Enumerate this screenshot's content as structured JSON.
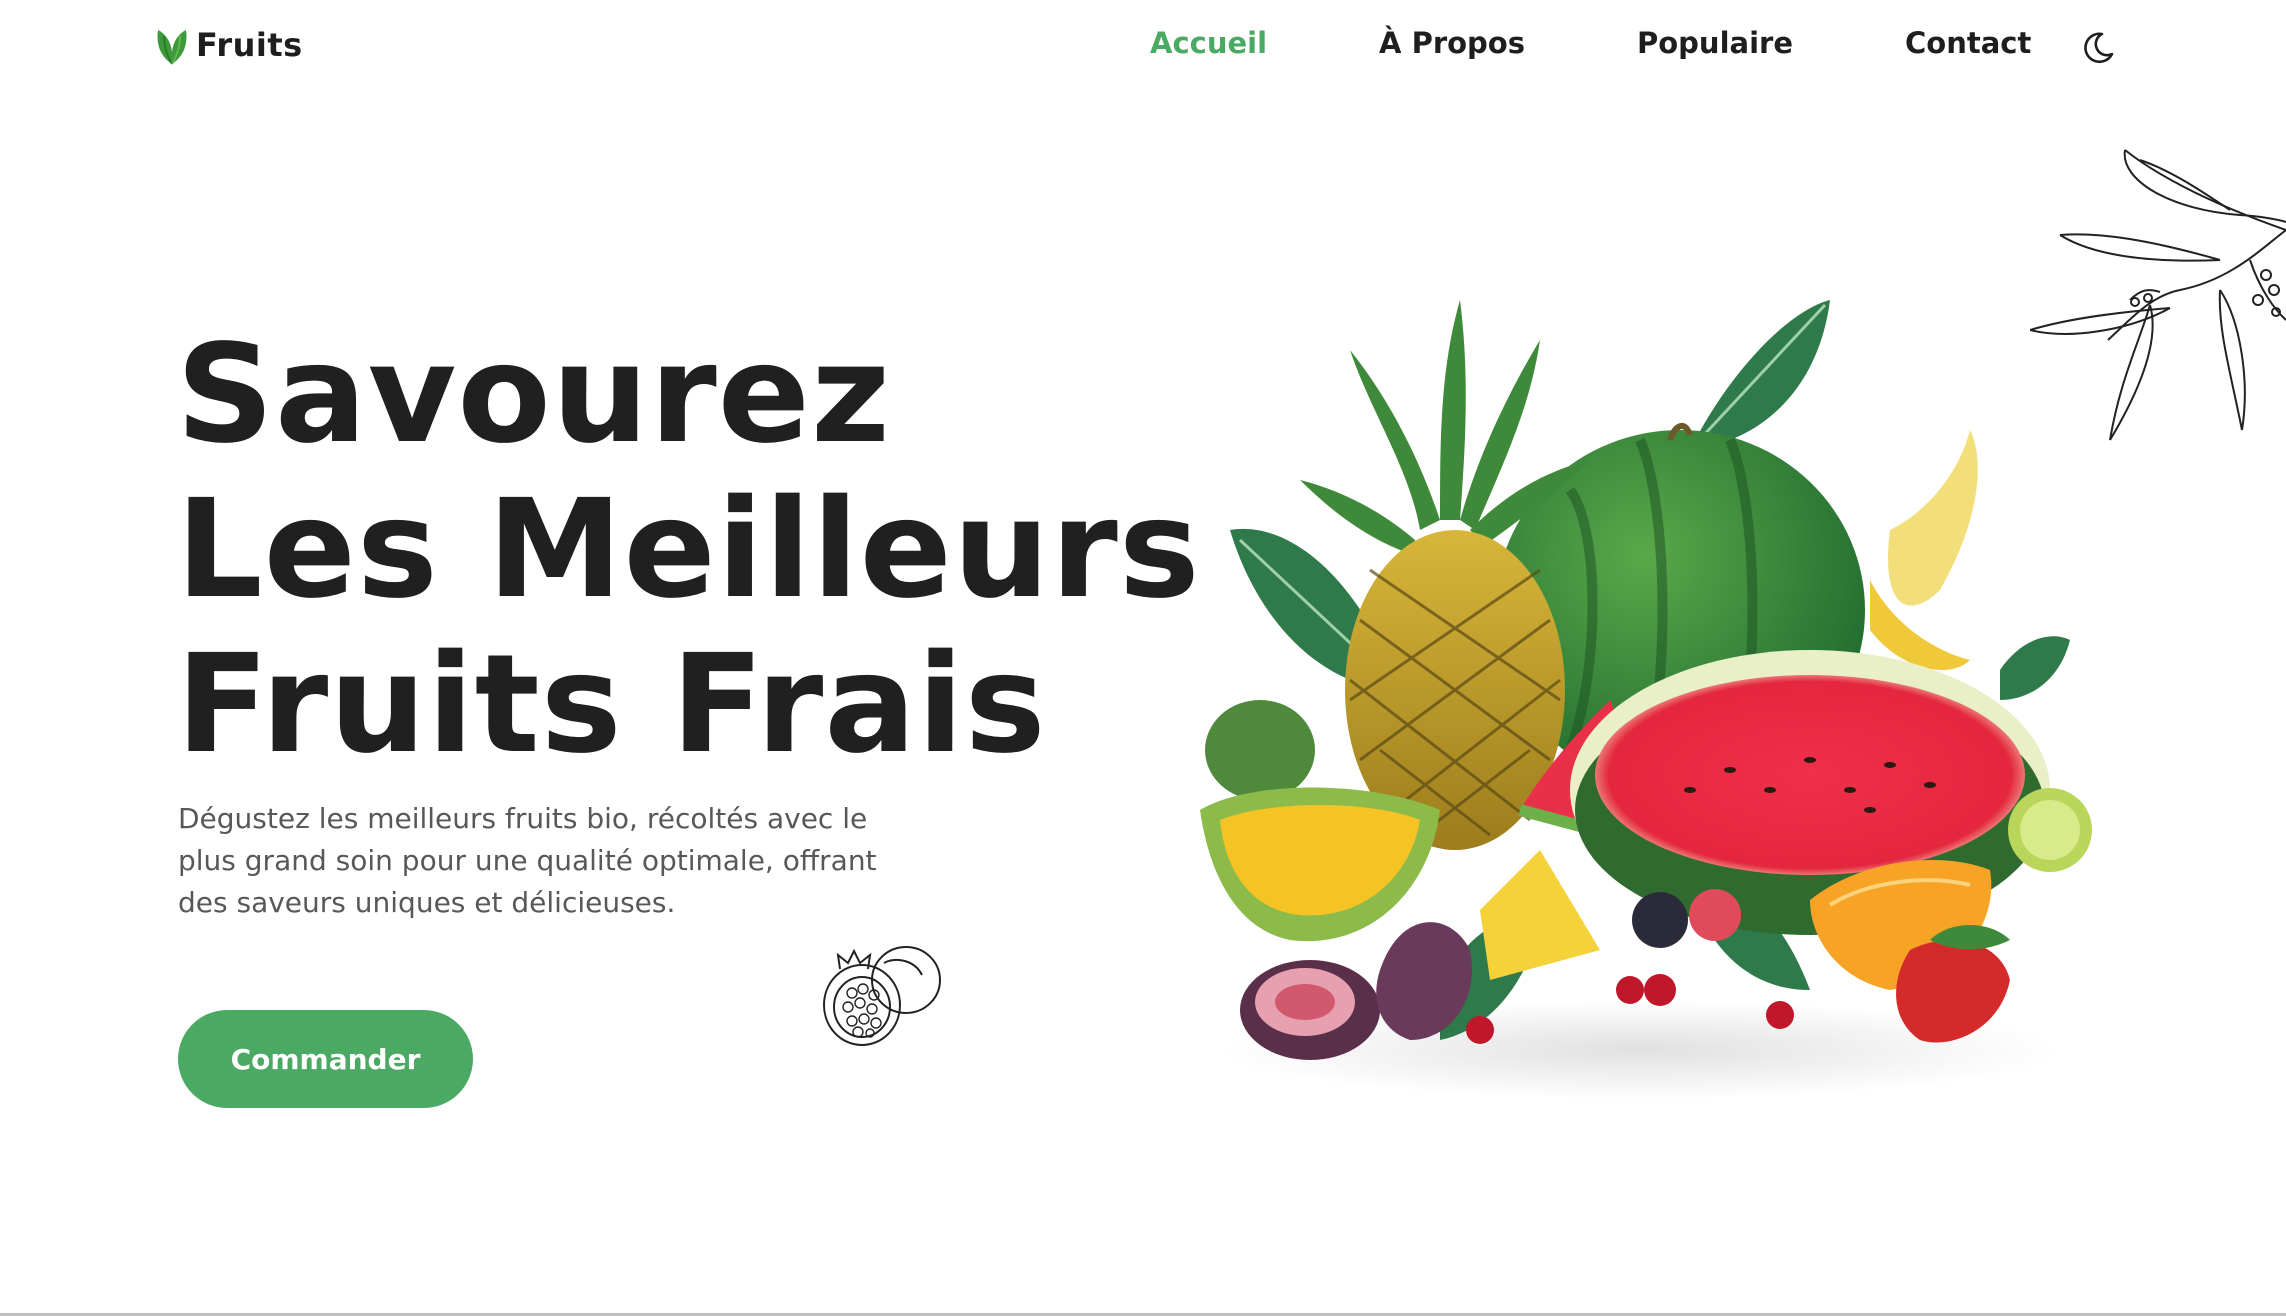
{
  "brand": {
    "name": "Fruits",
    "logo_icon": "leaf-icon",
    "accent_color": "#4aaa64"
  },
  "nav": {
    "items": [
      {
        "label": "Accueil",
        "active": true
      },
      {
        "label": "À Propos",
        "active": false
      },
      {
        "label": "Populaire",
        "active": false
      },
      {
        "label": "Contact",
        "active": false
      }
    ],
    "theme_toggle_icon": "moon-icon"
  },
  "hero": {
    "title_lines": [
      "Savourez",
      "Les Meilleurs",
      "Fruits Frais"
    ],
    "description": "Dégustez les meilleurs fruits bio, récoltés avec le plus grand soin pour une qualité optimale, offrant des saveurs uniques et délicieuses.",
    "cta_label": "Commander",
    "image_icon": "fruit-basket-illustration"
  }
}
